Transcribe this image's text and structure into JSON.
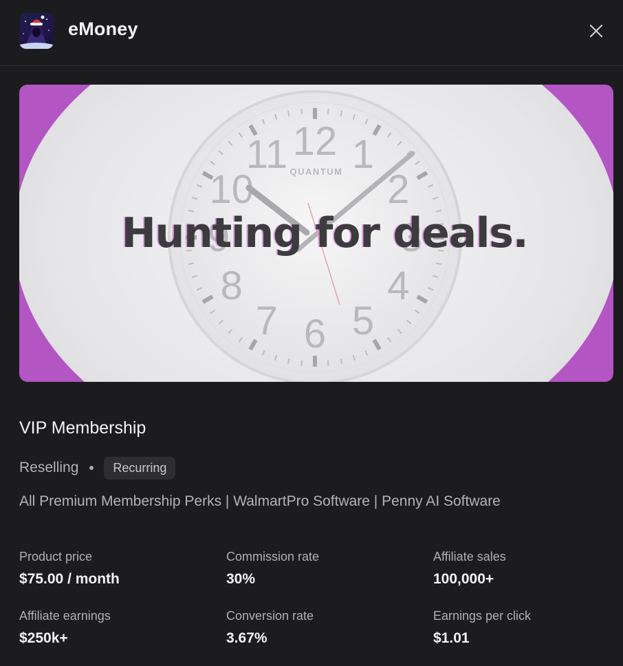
{
  "header": {
    "app_name": "eMoney",
    "icon": "avatar-hooded-figure-icon",
    "close_icon": "close-icon"
  },
  "hero": {
    "headline": "Hunting for deals.",
    "clock_brand": "QUANTUM",
    "clock_numbers": [
      "12",
      "1",
      "2",
      "3",
      "4",
      "5",
      "6",
      "7",
      "8",
      "9",
      "10",
      "11"
    ],
    "background_color": "#b455c4"
  },
  "product": {
    "title": "VIP Membership",
    "category": "Reselling",
    "badge": "Recurring",
    "description": "All Premium Membership Perks | WalmartPro Software | Penny AI Software"
  },
  "stats": [
    {
      "label": "Product price",
      "value": "$75.00 / month"
    },
    {
      "label": "Commission rate",
      "value": "30%"
    },
    {
      "label": "Affiliate sales",
      "value": "100,000+"
    },
    {
      "label": "Affiliate earnings",
      "value": "$250k+"
    },
    {
      "label": "Conversion rate",
      "value": "3.67%"
    },
    {
      "label": "Earnings per click",
      "value": "$1.01"
    }
  ]
}
